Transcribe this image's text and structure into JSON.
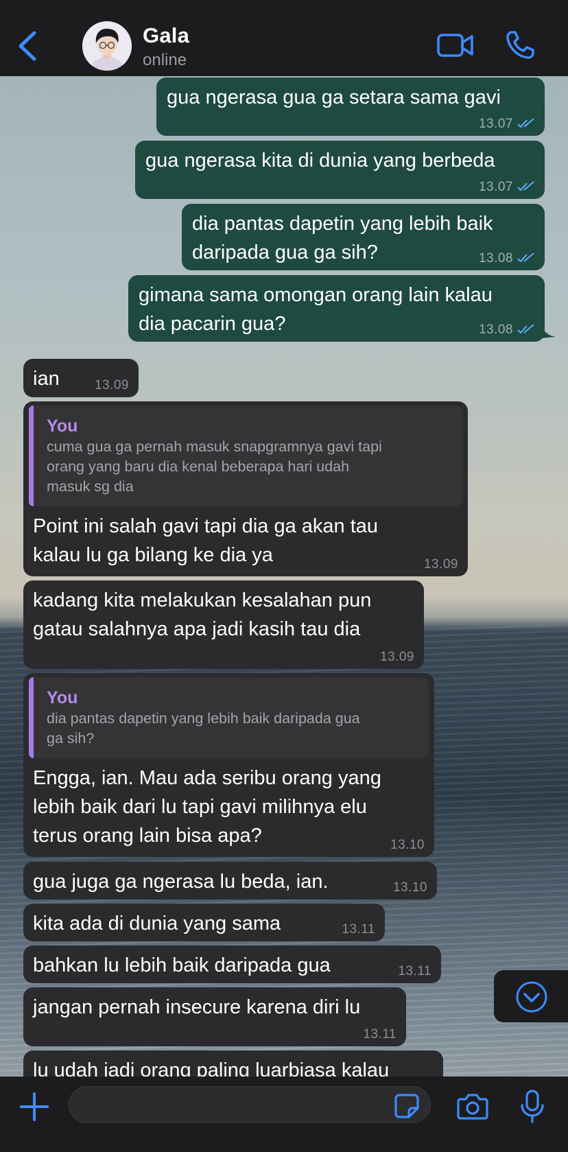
{
  "contact": {
    "name": "Gala",
    "status": "online"
  },
  "messages": [
    {
      "dir": "out",
      "text": "gua ngerasa gua ga setara sama gavi",
      "time": "13.07",
      "read": true
    },
    {
      "dir": "out",
      "text": "gua ngerasa kita di dunia yang berbeda",
      "time": "13.07",
      "read": true
    },
    {
      "dir": "out",
      "text": "dia pantas dapetin yang lebih baik\ndaripada gua ga sih?",
      "time": "13.08",
      "read": true
    },
    {
      "dir": "out",
      "text": "gimana sama omongan orang lain kalau\ndia pacarin gua?",
      "time": "13.08",
      "read": true
    },
    {
      "dir": "in",
      "text": "ian",
      "time": "13.09"
    },
    {
      "dir": "in",
      "quote": {
        "author": "You",
        "text": "cuma gua ga pernah masuk snapgramnya gavi tapi\norang yang baru dia kenal beberapa hari udah\nmasuk sg dia"
      },
      "text": "Point ini salah gavi tapi dia ga akan tau\nkalau lu ga bilang ke dia ya",
      "time": "13.09"
    },
    {
      "dir": "in",
      "text": "kadang kita melakukan kesalahan pun\ngatau salahnya apa jadi kasih tau dia",
      "time": "13.09"
    },
    {
      "dir": "in",
      "quote": {
        "author": "You",
        "text": "dia pantas dapetin yang lebih baik daripada gua\nga sih?"
      },
      "text": "Engga, ian. Mau ada seribu orang yang\nlebih baik dari lu tapi gavi milihnya elu\nterus orang lain bisa apa?",
      "time": "13.10"
    },
    {
      "dir": "in",
      "text": "gua juga ga ngerasa lu beda, ian.",
      "time": "13.10"
    },
    {
      "dir": "in",
      "text": "kita ada di dunia yang sama",
      "time": "13.11"
    },
    {
      "dir": "in",
      "text": "bahkan lu lebih baik daripada gua",
      "time": "13.11"
    },
    {
      "dir": "in",
      "text": "jangan pernah insecure karena diri lu",
      "time": "13.11"
    },
    {
      "dir": "in",
      "text": "lu udah jadi orang paling luarbiasa kalau",
      "time": ""
    }
  ],
  "composer": {
    "placeholder": ""
  },
  "colors": {
    "accent": "#3d8bff",
    "outgoing_bubble": "#1f4a40",
    "incoming_bubble": "#2b2b2e",
    "quote_accent": "#a67be0"
  },
  "icons": [
    "back-chevron-icon",
    "video-call-icon",
    "phone-icon",
    "scroll-down-icon",
    "plus-icon",
    "sticker-icon",
    "camera-icon",
    "microphone-icon"
  ]
}
